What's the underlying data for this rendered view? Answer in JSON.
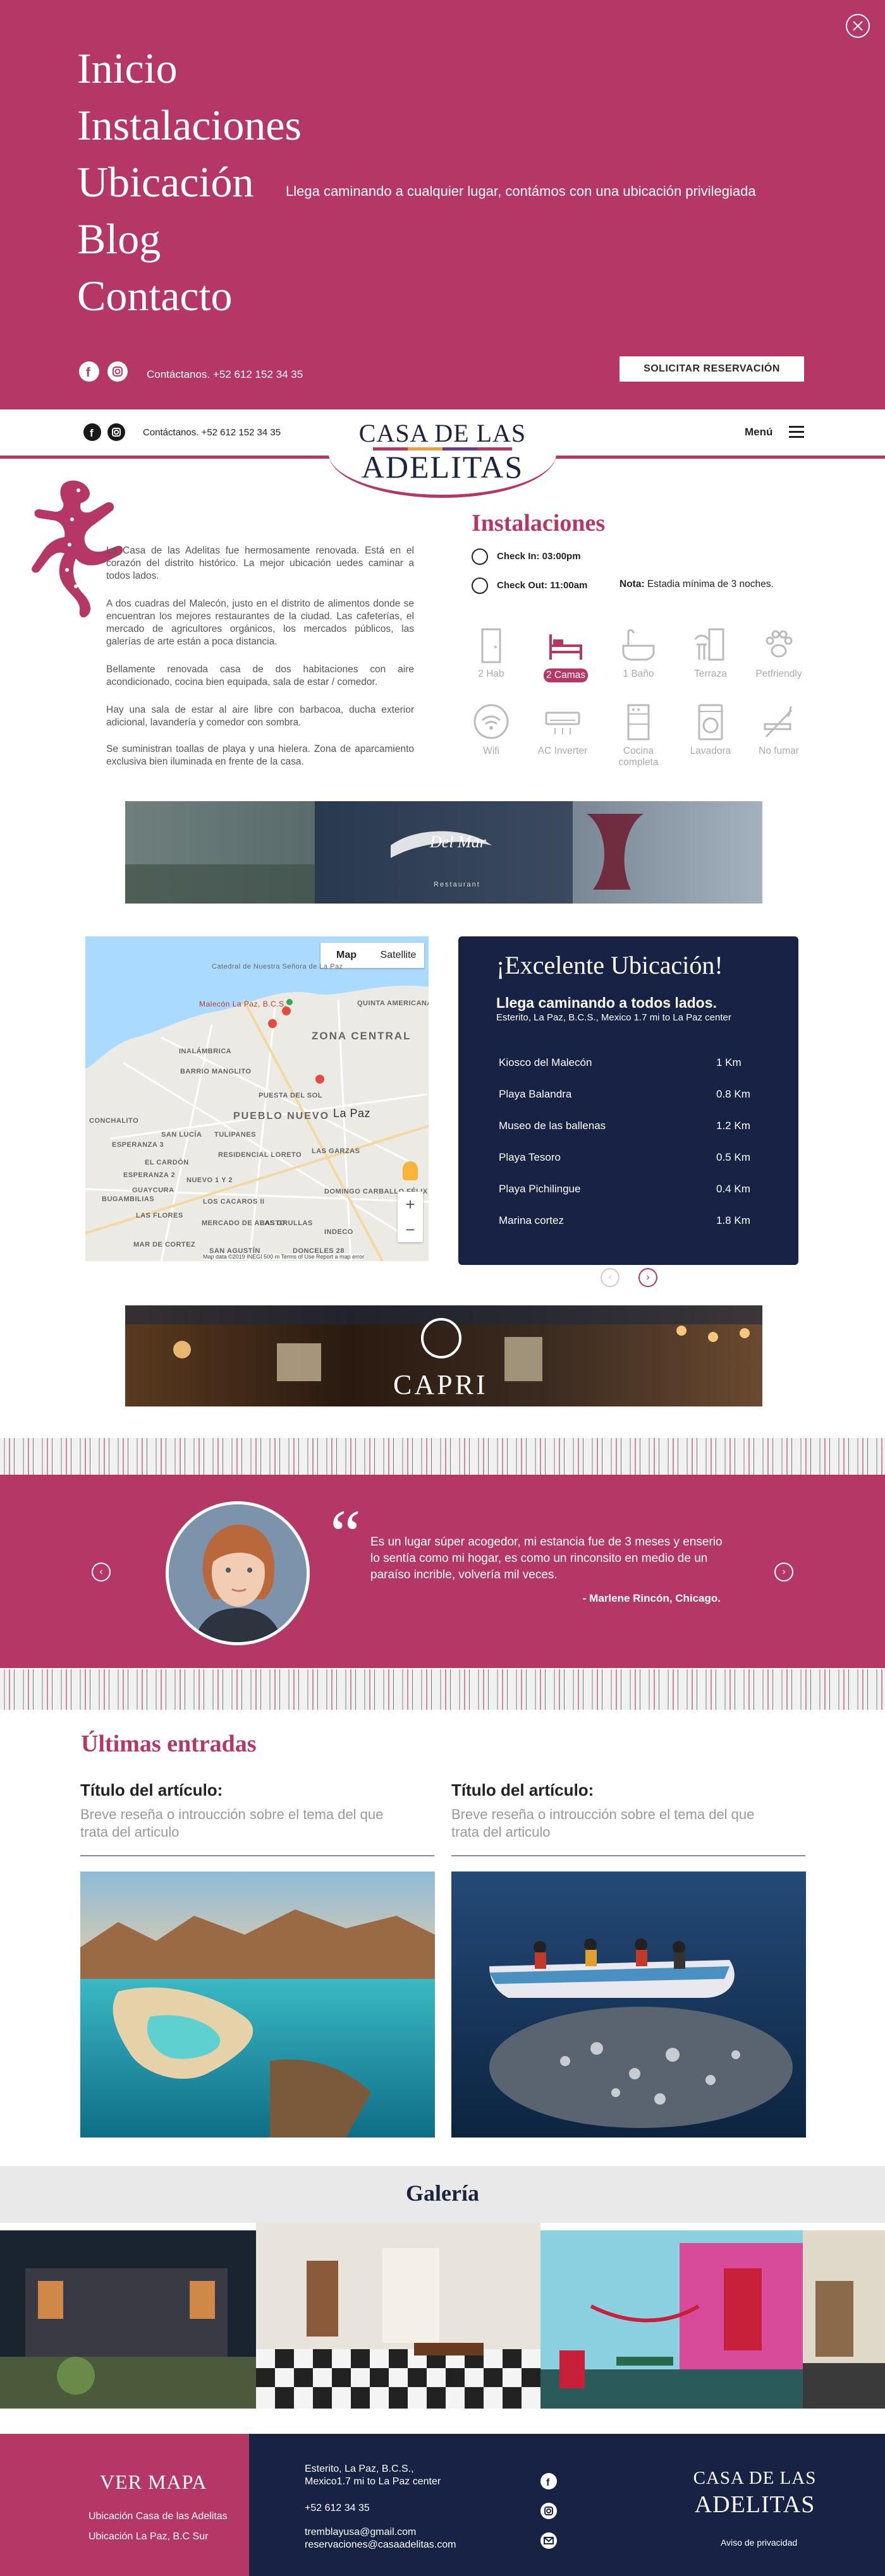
{
  "overlay": {
    "menu": [
      "Inicio",
      "Instalaciones",
      "Ubicación",
      "Blog",
      "Contacto"
    ],
    "tagline": "Llega caminando a cualquier lugar, contámos con una ubicación privilegiada",
    "contact": "Contáctanos. +52 612 152 34 35",
    "cta": "SOLICITAR RESERVACIÓN"
  },
  "header": {
    "contact": "Contáctanos. +52 612 152 34 35",
    "logo_top": "CASA DE LAS",
    "logo_bottom": "ADELITAS",
    "menu_label": "Menú"
  },
  "intro": {
    "p1": "La Casa de las Adelitas fue hermosamente renovada. Está en el corazón del distrito histórico. La mejor ubicación uedes caminar a todos lados.",
    "p2": "A dos cuadras del Malecón, justo en el distrito de alimentos donde se encuentran los mejores restaurantes de la ciudad. Las cafeterías, el mercado de agricultores orgánicos, los mercados públicos, las galerías de arte están a poca distancia.",
    "p3": "Bellamente renovada casa de dos habitaciones con aire acondicionado, cocina bien equipada, sala de estar / comedor.",
    "p4": "Hay una sala de estar al aire libre con barbacoa, ducha exterior adicional, lavandería y comedor con sombra.",
    "p5": "Se suministran toallas de playa y una hielera. Zona de aparcamiento exclusiva bien iluminada en frente de la casa."
  },
  "instalaciones": {
    "title": "Instalaciones",
    "check_in": "Check In: 03:00pm",
    "check_out": "Check Out: 11:00am",
    "note_label": "Nota:",
    "note_text": "Estadia mínima de 3 noches.",
    "amenities": [
      {
        "label": "2 Hab",
        "icon": "door-icon",
        "active": false
      },
      {
        "label": "2 Camas",
        "icon": "bed-icon",
        "active": true
      },
      {
        "label": "1 Baño",
        "icon": "bathtub-icon",
        "active": false
      },
      {
        "label": "Terraza",
        "icon": "terrace-icon",
        "active": false
      },
      {
        "label": "Petfriendly",
        "icon": "paw-icon",
        "active": false
      },
      {
        "label": "Wifi",
        "icon": "wifi-icon",
        "active": false
      },
      {
        "label": "AC Inverter",
        "icon": "air-conditioner-icon",
        "active": false
      },
      {
        "label": "Cocina completa",
        "icon": "stove-icon",
        "active": false
      },
      {
        "label": "Lavadora",
        "icon": "washing-machine-icon",
        "active": false
      },
      {
        "label": "No fumar",
        "icon": "no-smoking-icon",
        "active": false
      }
    ]
  },
  "banner1": {
    "brand": "Del Mar",
    "sub": "Restaurant"
  },
  "map": {
    "tab_map": "Map",
    "tab_satellite": "Satellite",
    "labels": [
      "Catedral de Nuestra Señora de La Paz",
      "Malecón La Paz, B.C.S.",
      "QUINTA AMERICANA",
      "ZONA CENTRAL",
      "INALÁMBRICA",
      "BARRIO MANGLITO",
      "PUESTA DEL SOL",
      "PUEBLO NUEVO",
      "La Paz",
      "CONCHALITO",
      "ESPERANZA 3",
      "SAN LUCÍA",
      "TULIPANES",
      "EL CARDÓN",
      "RESIDENCIAL LORETO",
      "ESPERANZA 2",
      "LAS GARZAS",
      "GUAYCURA",
      "NUEVO 1 Y 2",
      "BUGAMBILIAS",
      "LOS CACAROS II",
      "DOMINGO CARBALLO FÉLIX",
      "LAS FLORES",
      "MERCADO DE ABASTO",
      "LAS GRULLAS",
      "INDECO",
      "MAR DE CORTEZ",
      "SAN AGUSTÍN",
      "DONCELES 28"
    ],
    "attribution": "Map data ©2019 INEGI  500 m  Terms of Use  Report a map error"
  },
  "location": {
    "title": "¡Excelente Ubicación!",
    "subtitle": "Llega caminando a todos lados.",
    "address": "Esterito, La Paz, B.C.S., Mexico 1.7 mi to La Paz center",
    "places": [
      {
        "name": "Kiosco del Malecón",
        "dist": "1 Km"
      },
      {
        "name": "Playa Balandra",
        "dist": "0.8 Km"
      },
      {
        "name": "Museo de las ballenas",
        "dist": "1.2 Km"
      },
      {
        "name": "Playa Tesoro",
        "dist": "0.5 Km"
      },
      {
        "name": "Playa Pichilingue",
        "dist": "0.4 Km"
      },
      {
        "name": "Marina cortez",
        "dist": "1.8 Km"
      }
    ]
  },
  "banner2": {
    "brand": "CAPRI"
  },
  "testimonial": {
    "text": "Es un lugar súper acogedor, mi estancia fue de 3 meses y enserio lo sentía como mi hogar, es como un rinconsito en medio de un paraíso incrible, volvería mil veces.",
    "author": "- Marlene Rincón, Chicago."
  },
  "blog": {
    "title": "Últimas entradas",
    "articles": [
      {
        "title": "Título del artículo:",
        "desc": "Breve reseña o introucción sobre el tema del que trata del articulo"
      },
      {
        "title": "Título del artículo:",
        "desc": "Breve reseña o introucción sobre el tema del que trata del articulo"
      }
    ]
  },
  "gallery": {
    "title": "Galería"
  },
  "footer": {
    "ver_mapa": "VER MAPA",
    "link1": "Ubicación Casa de las Adelitas",
    "link2": "Ubicación La Paz, B.C Sur",
    "addr1": "Esterito, La Paz, B.C.S.,",
    "addr2": "Mexico1.7 mi to La Paz center",
    "phone": "+52 612 34 35",
    "email1": "tremblayusa@gmail.com",
    "email2": "reservaciones@casaadelitas.com",
    "logo_top": "CASA DE LAS",
    "logo_bottom": "ADELITAS",
    "privacy": "Aviso de privacidad"
  },
  "colors": {
    "brand": "#b53765",
    "navy": "#172245",
    "white": "#ffffff"
  }
}
